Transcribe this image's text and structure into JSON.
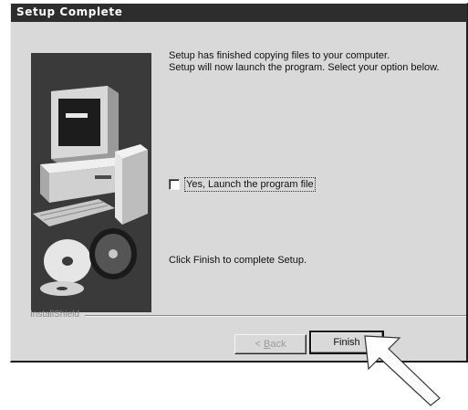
{
  "window": {
    "title": "Setup Complete"
  },
  "message": {
    "line1": "Setup has finished copying files to your computer.",
    "line2": "Setup will now launch the program. Select your option below."
  },
  "launch_option": {
    "label": "Yes, Launch the program file",
    "checked": false
  },
  "finish_hint": "Click Finish to complete Setup.",
  "brand": "InstallShield",
  "buttons": {
    "back_prefix": "< ",
    "back_mnemonic": "B",
    "back_rest": "ack",
    "finish": "Finish"
  },
  "icons": {
    "illustration": "computer-with-cds-illustration",
    "pointer": "pointer-arrow-icon"
  },
  "colors": {
    "title_bar": "#2d2d2d",
    "dialog_bg": "#d9d9d9",
    "panel_bg": "#3a3a3a"
  }
}
